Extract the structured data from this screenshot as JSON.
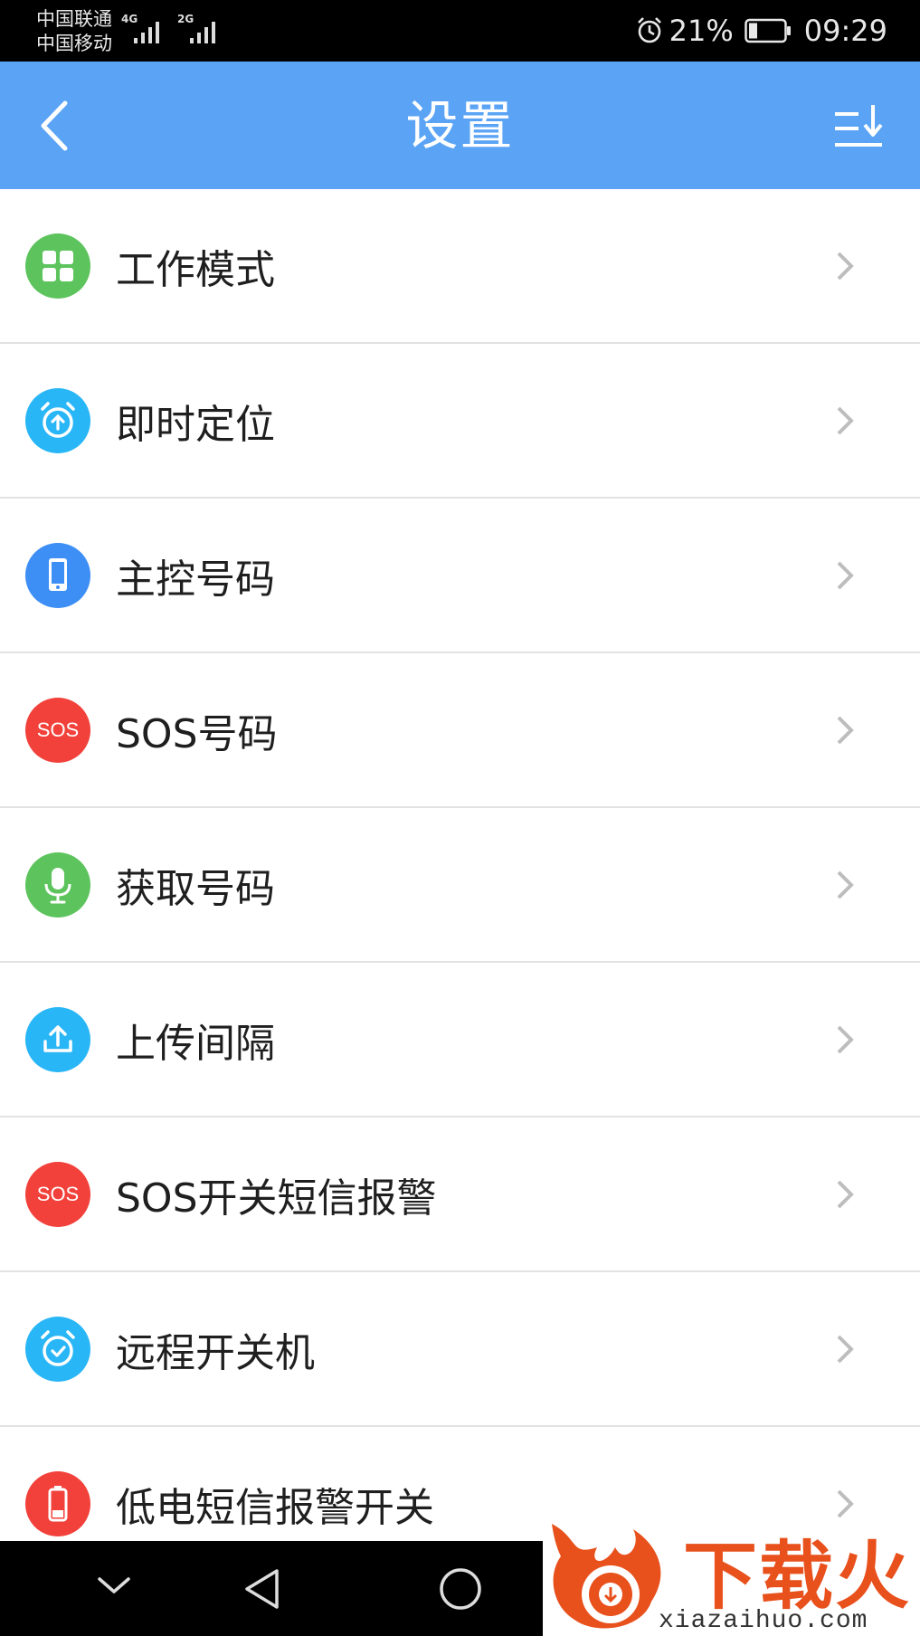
{
  "status_bar": {
    "carrier1": "中国联通",
    "carrier2": "中国移动",
    "net1": "4G",
    "net2": "2G",
    "battery": "21%",
    "time": "09:29",
    "icons": [
      "alarm-icon",
      "battery-icon"
    ]
  },
  "header": {
    "title": "设置",
    "back_icon": "chevron-left-icon",
    "sort_icon": "sort-down-icon"
  },
  "settings": {
    "items": [
      {
        "label": "工作模式",
        "icon": "grid-icon",
        "color": "#5dc45d"
      },
      {
        "label": "即时定位",
        "icon": "alarm-clock-upload-icon",
        "color": "#29b6f6"
      },
      {
        "label": "主控号码",
        "icon": "phone-icon",
        "color": "#3d8ef5"
      },
      {
        "label": "SOS号码",
        "icon": "sos-icon",
        "color": "#f2413b",
        "icon_text": "SOS"
      },
      {
        "label": "获取号码",
        "icon": "microphone-icon",
        "color": "#5dc45d"
      },
      {
        "label": "上传间隔",
        "icon": "upload-icon",
        "color": "#29b6f6"
      },
      {
        "label": "SOS开关短信报警",
        "icon": "sos-icon",
        "color": "#f2413b",
        "icon_text": "SOS"
      },
      {
        "label": "远程开关机",
        "icon": "alarm-clock-check-icon",
        "color": "#29b6f6"
      },
      {
        "label": "低电短信报警开关",
        "icon": "battery-low-icon",
        "color": "#f2413b"
      }
    ]
  },
  "nav_bar": {
    "buttons": [
      "chevron-down-icon",
      "back-triangle-icon",
      "home-circle-icon",
      "recents-square-icon"
    ]
  },
  "watermark": {
    "text": "下载火",
    "url": "xiazaihuo.com",
    "colors": {
      "brand": "#e8501c"
    }
  },
  "colors": {
    "header_bg": "#5aa3f5",
    "divider": "#e2e2e2",
    "chevron": "#bdbdbd"
  }
}
